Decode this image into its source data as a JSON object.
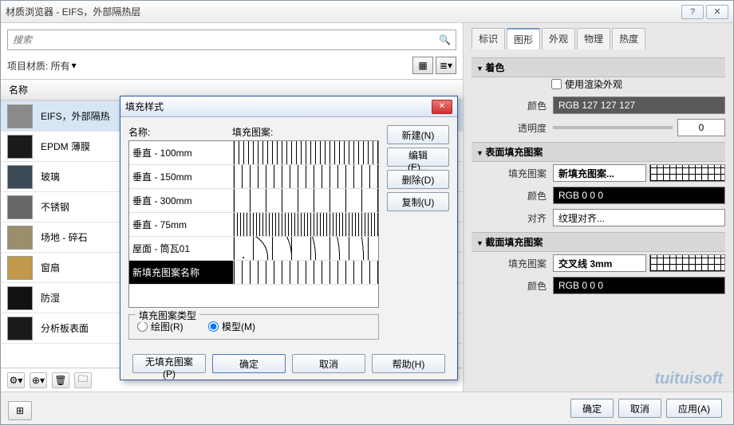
{
  "window": {
    "title": "材质浏览器 - EIFS，外部隔热层"
  },
  "search": {
    "placeholder": "搜索"
  },
  "filter": {
    "label": "项目材质: 所有"
  },
  "listhead": "名称",
  "materials": [
    {
      "name": "EIFS，外部隔热",
      "sel": true,
      "color": "#8a8a8a"
    },
    {
      "name": "EPDM 薄膜",
      "color": "#1a1a1a"
    },
    {
      "name": "玻璃",
      "color": "#3c4a55"
    },
    {
      "name": "不锈钢",
      "color": "#666"
    },
    {
      "name": "场地 - 碎石",
      "color": "#9a8f6a"
    },
    {
      "name": "窗扇",
      "color": "#c09a4a"
    },
    {
      "name": "防湿",
      "color": "#111"
    },
    {
      "name": "分析板表面",
      "color": "#1a1a1a"
    }
  ],
  "tabs": {
    "t0": "标识",
    "t1": "图形",
    "t2": "外观",
    "t3": "物理",
    "t4": "热度",
    "active": 1
  },
  "shade": {
    "h": "着色",
    "render": "使用渲染外观",
    "colorL": "颜色",
    "colorV": "RGB 127 127 127",
    "transL": "透明度",
    "transV": "0"
  },
  "surf": {
    "h": "表面填充图案",
    "patL": "填充图案",
    "patV": "新填充图案...",
    "colorL": "颜色",
    "colorV": "RGB 0 0 0",
    "alignL": "对齐",
    "alignV": "纹理对齐..."
  },
  "cut": {
    "h": "截面填充图案",
    "patL": "填充图案",
    "patV": "交叉线 3mm",
    "colorL": "颜色",
    "colorV": "RGB 0 0 0"
  },
  "footer": {
    "ok": "确定",
    "cancel": "取消",
    "apply": "应用(A)"
  },
  "dlg": {
    "title": "填充样式",
    "nameH": "名称:",
    "patH": "填充图案:",
    "rows": [
      {
        "name": "垂直 - 100mm",
        "cls": "vlines"
      },
      {
        "name": "垂直 - 150mm",
        "cls": "vlines2"
      },
      {
        "name": "垂直 - 300mm",
        "cls": "vlines3"
      },
      {
        "name": "垂直 - 75mm",
        "cls": "vlines4"
      },
      {
        "name": "屋面 - 筒瓦01",
        "cls": "tiles"
      },
      {
        "name": "新填充图案名称",
        "cls": "vlines2",
        "sel": true
      }
    ],
    "btns": {
      "new": "新建(N)",
      "edit": "编辑(E)...",
      "del": "删除(D)",
      "dup": "复制(U)"
    },
    "ptype": {
      "legend": "填充图案类型",
      "draw": "绘图(R)",
      "model": "模型(M)"
    },
    "foot": {
      "none": "无填充图案(P)",
      "ok": "确定",
      "cancel": "取消",
      "help": "帮助(H)"
    }
  },
  "watermark": "tuituisoft"
}
